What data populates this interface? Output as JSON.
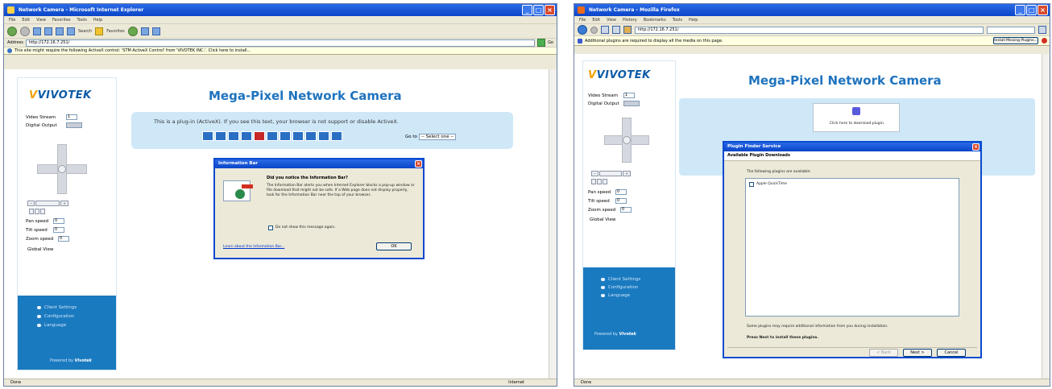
{
  "left_window": {
    "title": "Network Camera - Microsoft Internet Explorer",
    "menu": [
      "File",
      "Edit",
      "View",
      "Favorites",
      "Tools",
      "Help"
    ],
    "toolbar_search": "Search",
    "toolbar_favorites": "Favorites",
    "address_label": "Address",
    "address_value": "http://172.16.7.251/",
    "go_label": "Go",
    "infobar_text": "This site might require the following ActiveX control: 'STM ActiveX Control' from 'VIVOTEK INC.'. Click here to install...",
    "status_left": "Done",
    "status_zone": "Internet",
    "page": {
      "logo": "VIVOTEK",
      "heading": "Mega-Pixel Network Camera",
      "video_stream_label": "Video Stream",
      "video_stream_value": "1",
      "digital_output_label": "Digital Output",
      "pan_speed_label": "Pan speed",
      "pan_speed_value": "0",
      "tilt_speed_label": "Tilt speed",
      "tilt_speed_value": "0",
      "zoom_speed_label": "Zoom speed",
      "zoom_speed_value": "0",
      "global_view": "Global View",
      "client_settings": "Client Settings",
      "configuration": "Configuration",
      "language": "Language",
      "powered_by": "Powered by",
      "powered_brand": "Vivotek",
      "plugin_message": "This is a plug-in (ActiveX). If you see this text, your browser is not support or disable ActiveX.",
      "goto_label": "Go to",
      "goto_value": "-- Select one --"
    },
    "dialog": {
      "title": "Information Bar",
      "heading": "Did you notice the Information Bar?",
      "body": "The Information Bar alerts you when Internet Explorer blocks a pop-up window or file download that might not be safe. If a Web page does not display properly, look for the Information Bar near the top of your browser.",
      "checkbox_label": "Do not show this message again.",
      "link": "Learn about the Information Bar...",
      "ok": "OK"
    }
  },
  "right_window": {
    "title": "Network Camera - Mozilla Firefox",
    "menu": [
      "File",
      "Edit",
      "View",
      "History",
      "Bookmarks",
      "Tools",
      "Help"
    ],
    "address_value": "http://172.16.7.251/",
    "notice_text": "Additional plugins are required to display all the media on this page.",
    "notice_button": "Install Missing Plugins...",
    "status_left": "Done",
    "page": {
      "logo": "VIVOTEK",
      "heading": "Mega-Pixel Network Camera",
      "video_stream_label": "Video Stream",
      "video_stream_value": "1",
      "digital_output_label": "Digital Output",
      "pan_speed_label": "Pan speed",
      "pan_speed_value": "0",
      "tilt_speed_label": "Tilt speed",
      "tilt_speed_value": "0",
      "zoom_speed_label": "Zoom speed",
      "zoom_speed_value": "0",
      "global_view": "Global View",
      "client_settings": "Client Settings",
      "configuration": "Configuration",
      "language": "Language",
      "powered_by": "Powered by",
      "powered_brand": "Vivotek",
      "download_text": "Click here to download plugin."
    },
    "dialog": {
      "title": "Plugin Finder Service",
      "subtitle": "Available Plugin Downloads",
      "list_intro": "The following plugins are available:",
      "plugin_item": "Apple QuickTime",
      "note": "Some plugins may require additional information from you during installation.",
      "next_note": "Press Next to install these plugins.",
      "back": "< Back",
      "next": "Next >",
      "cancel": "Cancel"
    }
  },
  "colors": {
    "ie_title": "#0a45c8",
    "brand_blue": "#1e73be",
    "panel_blue": "#1a7ac0"
  }
}
